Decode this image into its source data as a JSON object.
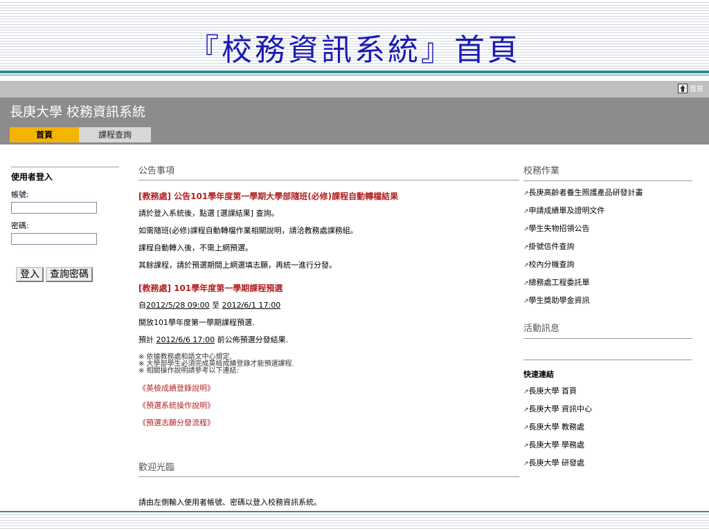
{
  "slide_title": "『校務資訊系統』首頁",
  "topbar": {
    "home_label": "首頁"
  },
  "header": {
    "site_title": "長庚大學 校務資訊系統"
  },
  "tabs": [
    {
      "label": "首頁"
    },
    {
      "label": "課程查詢"
    }
  ],
  "login": {
    "title": "使用者登入",
    "account_label": "帳號:",
    "account_value": "",
    "password_label": "密碼:",
    "password_value": "",
    "login_button": "登入",
    "lookup_button": "查詢密碼"
  },
  "announcements": {
    "heading": "公告事項",
    "news1": {
      "title": "[教務處] 公告101學年度第一學期大學部隨班(必修)課程自動轉檔結果",
      "line1_pre": "請於登入系統後，點選 ",
      "line1_link": "[選課結果]",
      "line1_post": " 查詢。",
      "line2": "如需隨班(必修)課程自動轉檔作業相關說明，請洽教務處課務組。",
      "line3": "課程自動轉入後，不需上網預選。",
      "line4": "其餘課程，請於預選期間上網選填志願，再統一進行分發。"
    },
    "news2": {
      "title": "[教務處] 101學年度第一學期課程預選",
      "line1_pre": "自",
      "line1_start": "2012/5/28 09:00",
      "line1_mid": " 至 ",
      "line1_end": "2012/6/1 17:00",
      "line2": "開放101學年度第一學期課程預選.",
      "line3_pre": "預計 ",
      "line3_date": "2012/6/6 17:00",
      "line3_post": " 前公佈預選分發結果.",
      "note1": "※ 依據教務處和語文中心規定,",
      "note2": "※ 大學部學生必須完成英檢成績登錄才能預選課程.",
      "note3": "※ 相關操作說明請參考以下連結:",
      "link1": "《英檢成績登錄說明》",
      "link2": "《預選系統操作說明》",
      "link3": "《預選志願分發流程》"
    }
  },
  "welcome": {
    "heading": "歡迎光臨",
    "text": "請由左側輸入使用者帳號、密碼以登入校務資訊系統。"
  },
  "right": {
    "heading": "校務作業",
    "items": [
      "長庚高齡者養生照護產品研發計畫",
      "申請成績單及證明文件",
      "學生失物招領公告",
      "掛號信件查詢",
      "校內分機查詢",
      "總務處工程委託單",
      "學生獎助學金資訊"
    ],
    "activity_heading": "活動訊息",
    "quick_title": "快速連結",
    "quick_links": [
      "長庚大學 首頁",
      "長庚大學 資訊中心",
      "長庚大學 教務處",
      "長庚大學 學務處",
      "長庚大學 研發處"
    ]
  },
  "colors": {
    "slide_title": "#1a1ab4",
    "teal_rule": "#2f8b91",
    "header_bg": "#8c8c8c",
    "tab_active": "#f4b400",
    "news_title": "#b22222"
  }
}
